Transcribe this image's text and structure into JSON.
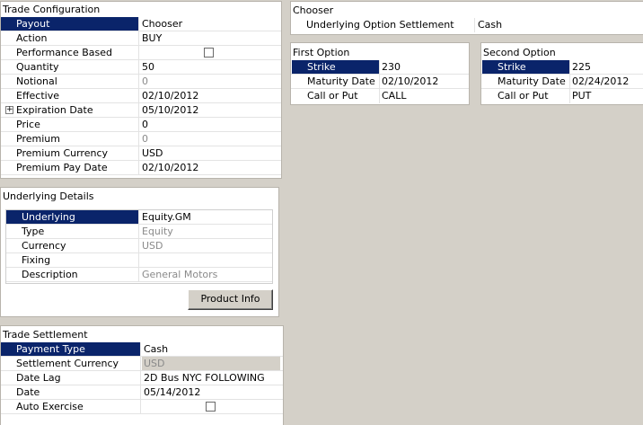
{
  "trade_configuration": {
    "title": "Trade Configuration",
    "rows": [
      {
        "label": "Payout",
        "value": "Chooser"
      },
      {
        "label": "Action",
        "value": "BUY"
      },
      {
        "label": "Performance Based",
        "value": "",
        "checkbox": true,
        "checked": false
      },
      {
        "label": "Quantity",
        "value": "50"
      },
      {
        "label": "Notional",
        "value": "0"
      },
      {
        "label": "Effective",
        "value": "02/10/2012"
      },
      {
        "label": "Expiration Date",
        "value": "05/10/2012"
      },
      {
        "label": "Price",
        "value": "0"
      },
      {
        "label": "Premium",
        "value": "0"
      },
      {
        "label": "Premium Currency",
        "value": "USD"
      },
      {
        "label": "Premium Pay Date",
        "value": "02/10/2012"
      }
    ]
  },
  "underlying_details": {
    "title": "Underlying Details",
    "rows": [
      {
        "label": "Underlying",
        "value": "Equity.GM"
      },
      {
        "label": "Type",
        "value": "Equity"
      },
      {
        "label": "Currency",
        "value": "USD"
      },
      {
        "label": "Fixing",
        "value": ""
      },
      {
        "label": "Description",
        "value": "General Motors"
      }
    ],
    "button_label": "Product Info"
  },
  "trade_settlement": {
    "title": "Trade Settlement",
    "rows": [
      {
        "label": "Payment Type",
        "value": "Cash"
      },
      {
        "label": "Settlement Currency",
        "value": "USD"
      },
      {
        "label": "Date Lag",
        "value": "2D Bus NYC FOLLOWING"
      },
      {
        "label": "Date",
        "value": "05/14/2012"
      },
      {
        "label": "Auto Exercise",
        "value": "",
        "checkbox": true,
        "checked": false
      }
    ]
  },
  "chooser": {
    "title": "Chooser",
    "rows": [
      {
        "label": "Underlying Option Settlement",
        "value": "Cash"
      }
    ]
  },
  "first_option": {
    "title": "First Option",
    "rows": [
      {
        "label": "Strike",
        "value": "230"
      },
      {
        "label": "Maturity Date",
        "value": "02/10/2012"
      },
      {
        "label": "Call or Put",
        "value": "CALL"
      }
    ]
  },
  "second_option": {
    "title": "Second Option",
    "rows": [
      {
        "label": "Strike",
        "value": "225"
      },
      {
        "label": "Maturity Date",
        "value": "02/24/2012"
      },
      {
        "label": "Call or Put",
        "value": "PUT"
      }
    ]
  },
  "colors": {
    "selection": "#0a246a",
    "background": "#d4d0c8",
    "panel": "#ffffff"
  }
}
